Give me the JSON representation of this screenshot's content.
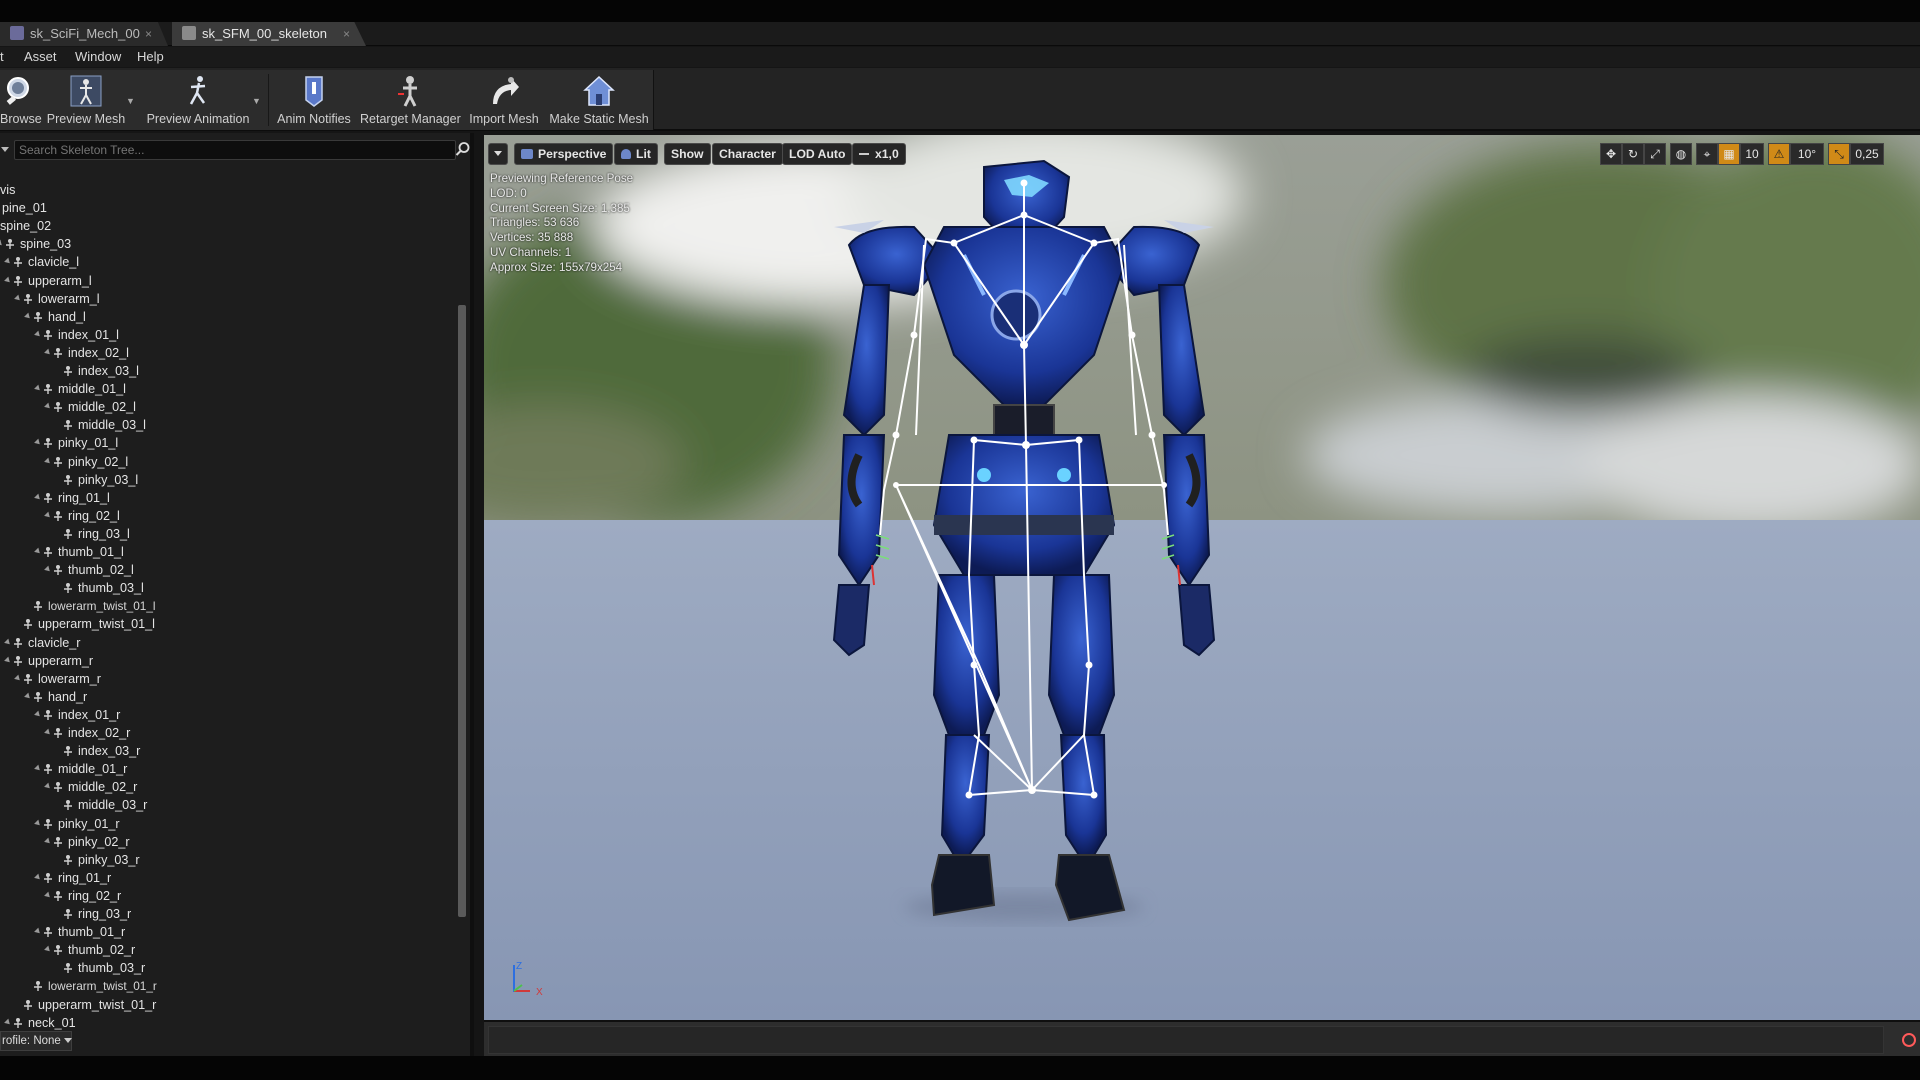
{
  "tabs": [
    {
      "label": "sk_SciFi_Mech_00",
      "active": false,
      "close": "×"
    },
    {
      "label": "sk_SFM_00_skeleton",
      "active": true,
      "close": "×"
    }
  ],
  "menu": [
    "t",
    "Asset",
    "Window",
    "Help"
  ],
  "toolbar": {
    "browse": "Browse",
    "preview_mesh": "Preview Mesh",
    "preview_animation": "Preview Animation",
    "anim_notifies": "Anim Notifies",
    "retarget_manager": "Retarget Manager",
    "import_mesh": "Import Mesh",
    "make_static_mesh": "Make Static Mesh",
    "icons": {
      "browse": "magnifier-icon",
      "preview_mesh": "skeletal-figure-icon",
      "preview_animation": "running-figure-icon",
      "anim_notifies": "notify-marker-icon",
      "retarget_manager": "retarget-figure-icon",
      "import_mesh": "import-arrow-icon",
      "make_static_mesh": "house-mesh-icon"
    }
  },
  "skeleton_tree": {
    "search_placeholder": "Search Skeleton Tree...",
    "bones": [
      "vis",
      "pine_01",
      "spine_02",
      "spine_03",
      "clavicle_l",
      "upperarm_l",
      "lowerarm_l",
      "hand_l",
      "index_01_l",
      "index_02_l",
      "index_03_l",
      "middle_01_l",
      "middle_02_l",
      "middle_03_l",
      "pinky_01_l",
      "pinky_02_l",
      "pinky_03_l",
      "ring_01_l",
      "ring_02_l",
      "ring_03_l",
      "thumb_01_l",
      "thumb_02_l",
      "thumb_03_l",
      "lowerarm_twist_01_l",
      "upperarm_twist_01_l",
      "clavicle_r",
      "upperarm_r",
      "lowerarm_r",
      "hand_r",
      "index_01_r",
      "index_02_r",
      "index_03_r",
      "middle_01_r",
      "middle_02_r",
      "middle_03_r",
      "pinky_01_r",
      "pinky_02_r",
      "pinky_03_r",
      "ring_01_r",
      "ring_02_r",
      "ring_03_r",
      "thumb_01_r",
      "thumb_02_r",
      "thumb_03_r",
      "lowerarm_twist_01_r",
      "upperarm_twist_01_r",
      "neck_01"
    ],
    "profile_label": "rofile: None"
  },
  "viewport": {
    "toolbar": {
      "perspective": "Perspective",
      "lit": "Lit",
      "show": "Show",
      "character": "Character",
      "lod": "LOD Auto",
      "speed": "x1,0",
      "grid_snap": "10",
      "rotation_snap": "10°",
      "scale_snap": "0,25"
    },
    "stats": [
      "Previewing Reference Pose",
      "LOD: 0",
      "Current Screen Size: 1,385",
      "Triangles: 53 636",
      "Vertices: 35 888",
      "UV Channels: 1",
      "Approx Size: 155x79x254"
    ],
    "axis": {
      "z": "Z",
      "x": "X"
    }
  },
  "colors": {
    "panel_bg": "#1d1d1d",
    "viewport_floor": "#8f9fb6",
    "robot_blue": "#1f3fa3",
    "bone_white": "#ffffff",
    "snap_active": "#e09a1e",
    "record": "#ff5a5a"
  }
}
